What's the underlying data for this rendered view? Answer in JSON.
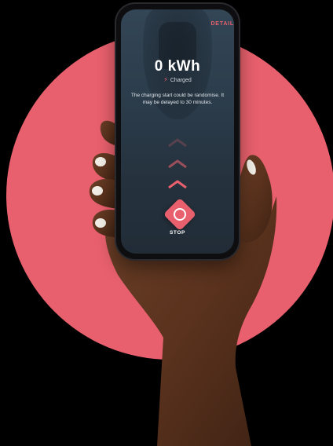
{
  "app": {
    "detail_label": "DETAIL",
    "energy_value": "0 kWh",
    "status_text": "Charged",
    "message": "The charging start could be randomise. It may be delayed to 30 minutes.",
    "stop_label": "STOP"
  },
  "icons": {
    "status": "lightning-bolt-icon",
    "stop": "circle-stop-icon",
    "progress": "chevron-up-icon"
  },
  "colors": {
    "accent": "#e8606d",
    "background": "#000000",
    "screen": "#2c3d4c"
  }
}
